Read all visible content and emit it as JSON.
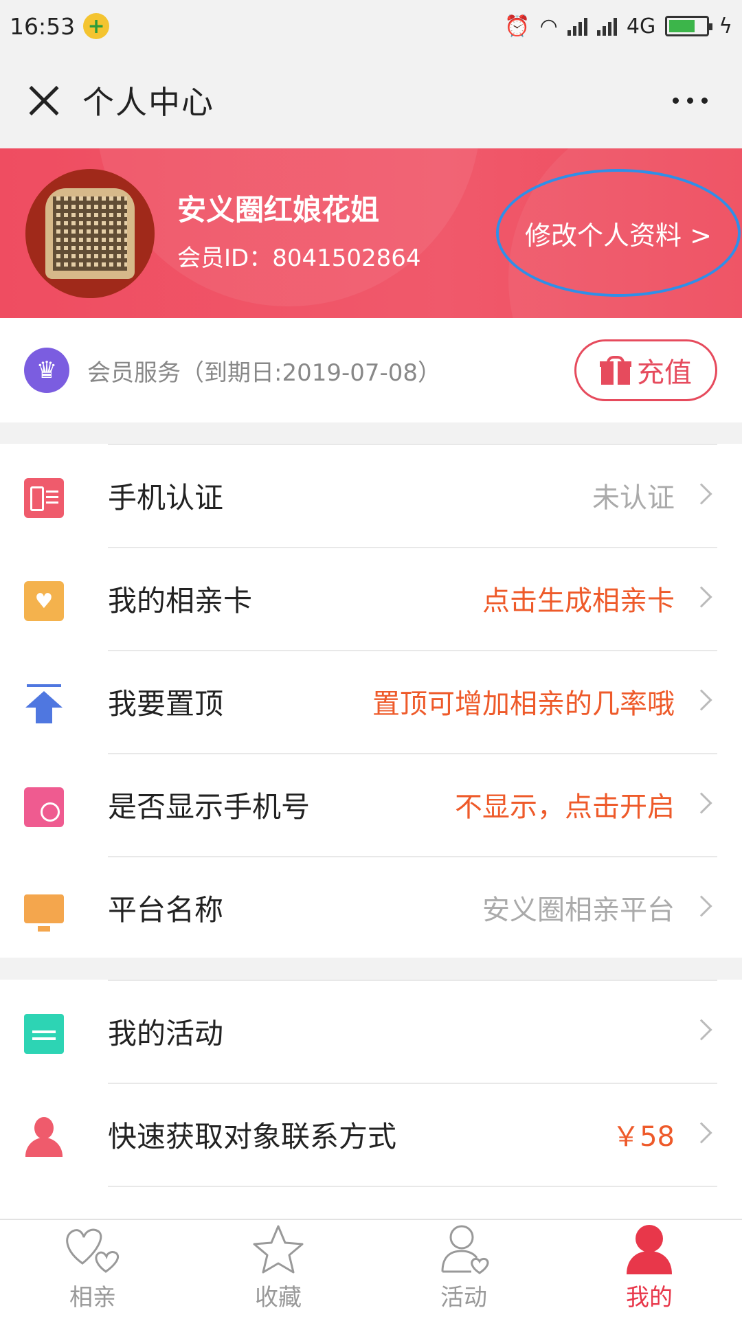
{
  "status_bar": {
    "time": "16:53",
    "network": "4G",
    "icons": [
      "alarm-icon",
      "wifi-icon",
      "signal-icon",
      "signal-icon",
      "battery-icon"
    ]
  },
  "titlebar": {
    "title": "个人中心"
  },
  "profile": {
    "name": "安义圈红娘花姐",
    "member_id": "会员ID：8041502864",
    "edit_label": "修改个人资料 >",
    "colors": {
      "header": "#ef4d61",
      "highlight_ring": "#2f8fe8"
    }
  },
  "membership": {
    "text": "会员服务（到期日:2019-07-08）",
    "recharge_label": "充值"
  },
  "group1": [
    {
      "label": "手机认证",
      "value": "未认证",
      "tone": "gray",
      "icon": "phone-card-icon"
    },
    {
      "label": "我的相亲卡",
      "value": "点击生成相亲卡",
      "tone": "orange",
      "icon": "heart-card-icon"
    },
    {
      "label": "我要置顶",
      "value": "置顶可增加相亲的几率哦",
      "tone": "orange",
      "icon": "pin-top-icon"
    },
    {
      "label": "是否显示手机号",
      "value": "不显示，点击开启",
      "tone": "orange",
      "icon": "phone-check-icon"
    },
    {
      "label": "平台名称",
      "value": "安义圈相亲平台",
      "tone": "gray",
      "icon": "certificate-icon"
    }
  ],
  "group2": [
    {
      "label": "我的活动",
      "value": "",
      "tone": "gray",
      "icon": "calendar-icon"
    },
    {
      "label": "快速获取对象联系方式",
      "value": "￥58",
      "tone": "orange",
      "icon": "person-icon"
    }
  ],
  "bottom_nav": [
    {
      "label": "相亲",
      "icon": "hearts-icon",
      "active": false
    },
    {
      "label": "收藏",
      "icon": "star-icon",
      "active": false
    },
    {
      "label": "活动",
      "icon": "user-heart-icon",
      "active": false
    },
    {
      "label": "我的",
      "icon": "me-icon",
      "active": true
    }
  ]
}
